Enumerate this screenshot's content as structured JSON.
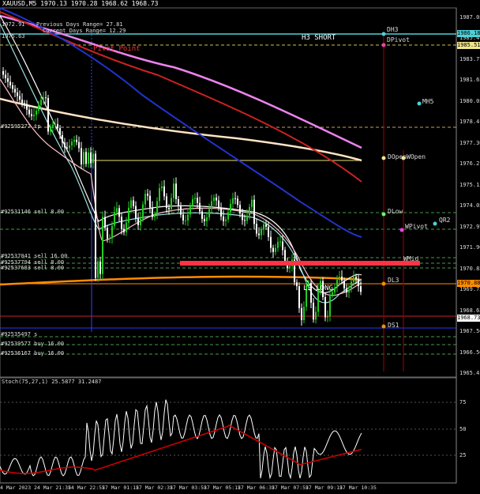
{
  "window": {
    "symbol": "XAUUSD,M5"
  },
  "header": {
    "quote_line": "1970.13 1970.28 1968.62 1968.73",
    "info_lines": [
      "Previous Days Range= 27.81",
      "Current Days Range= 12.29"
    ],
    "left_values": [
      "1972.91",
      "1975.63"
    ]
  },
  "price_axis": {
    "ticks": [
      "1987.05",
      "1985.41",
      "1983.77",
      "1981.65",
      "1980.05",
      "1978.41",
      "1977.30",
      "1976.21",
      "1975.13",
      "1974.05",
      "1972.97",
      "1971.90",
      "1970.82",
      "1969.75",
      "1968.65",
      "1967.56",
      "1966.50",
      "1965.41"
    ],
    "badges": [
      {
        "text": "1986.18",
        "bg": "#4fd1d8"
      },
      {
        "text": "1985.51",
        "bg": "#f0e68c"
      },
      {
        "text": "1970.88",
        "bg": "#ff8c00"
      },
      {
        "text": "1968.73",
        "bg": "#ffffff"
      }
    ]
  },
  "time_axis": {
    "ticks": [
      "4 Mar 2023",
      "24 Mar 21:35",
      "24 Mar 22:55",
      "27 Mar 01:15",
      "27 Mar 02:35",
      "27 Mar 03:55",
      "27 Mar 05:15",
      "27 Mar 06:35",
      "27 Mar 07:55",
      "27 Mar 09:15",
      "27 Mar 10:35"
    ]
  },
  "levels": [
    {
      "label": "H3 SHORT",
      "color": "#4fd1d8"
    },
    {
      "label": "Pivot Point",
      "color": "#ff3333"
    },
    {
      "label": "L3 LONG",
      "color": "#ffffff"
    }
  ],
  "pivot_labels": [
    "DH3",
    "DPivot",
    "MH5",
    "DOpen",
    "WOpen",
    "DLow",
    "QR2",
    "WPivot",
    "WMid",
    "DL3",
    "DS1"
  ],
  "order_labels": [
    "#92595277 tp",
    "#92531146 sell 8.00",
    "#92537041 sell 16.00",
    "#92537794 sell 8.00",
    "#92537683 sell 8.00",
    "#92535497 s",
    "#92539577 buy 16.00",
    "#92536167 buy 16.00"
  ],
  "indicator": {
    "label": "Stoch(75,27,1) 25.5877 31.2487",
    "ticks": [
      "75",
      "50",
      "25"
    ],
    "main_color": "#ffffff",
    "signal_color": "#cc0000"
  }
}
